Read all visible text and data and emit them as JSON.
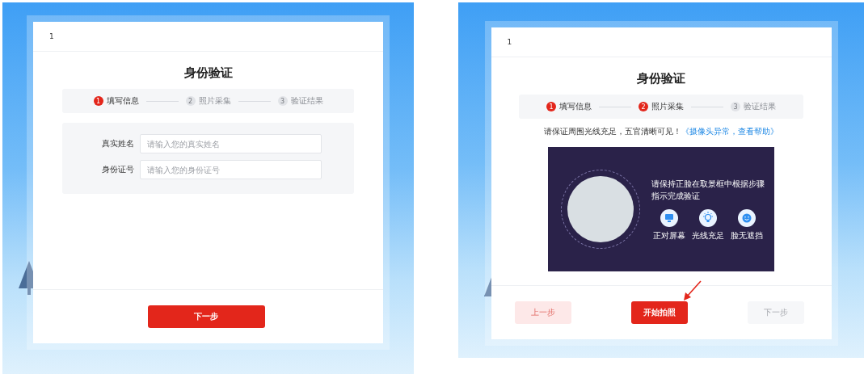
{
  "screens": [
    {
      "kind": "form",
      "header": "1",
      "title": "身份验证",
      "steps": [
        {
          "number": "1",
          "label": "填写信息",
          "active": true
        },
        {
          "number": "2",
          "label": "照片采集",
          "active": false
        },
        {
          "number": "3",
          "label": "验证结果",
          "active": false
        }
      ],
      "fields": [
        {
          "label": "真实姓名",
          "placeholder": "请输入您的真实姓名"
        },
        {
          "label": "身份证号",
          "placeholder": "请输入您的身份证号"
        }
      ],
      "buttons": [
        {
          "label": "下一步",
          "kind": "primary",
          "pointed": false
        }
      ]
    },
    {
      "kind": "camera",
      "header": "1",
      "title": "身份验证",
      "steps": [
        {
          "number": "1",
          "label": "填写信息",
          "active": true
        },
        {
          "number": "2",
          "label": "照片采集",
          "active": true
        },
        {
          "number": "3",
          "label": "验证结果",
          "active": false
        }
      ],
      "notice": "请保证周围光线充足，五官清晰可见！",
      "help_link": "《摄像头异常，查看帮助》",
      "guide": "请保持正脸在取景框中根据步骤指示完成验证",
      "tips": [
        {
          "kind": "screen",
          "label": "正对屏幕"
        },
        {
          "kind": "light",
          "label": "光线充足"
        },
        {
          "kind": "face",
          "label": "脸无遮挡"
        }
      ],
      "buttons": [
        {
          "label": "上一步",
          "kind": "light",
          "pointed": false
        },
        {
          "label": "开始拍照",
          "kind": "primary",
          "pointed": true
        },
        {
          "label": "下一步",
          "kind": "disabled",
          "pointed": false
        }
      ]
    }
  ]
}
